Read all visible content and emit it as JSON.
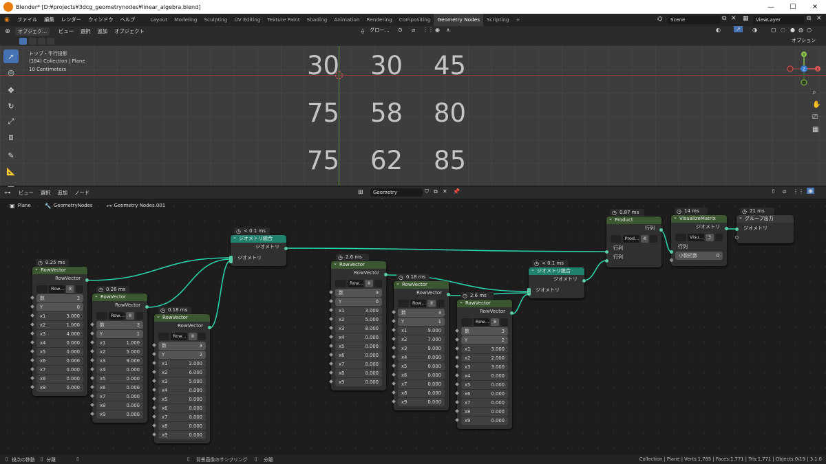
{
  "window": {
    "title": "Blender* [D:¥projects¥3dcg_geometrynodes¥linear_algebra.blend]",
    "min": "—",
    "max": "☐",
    "close": "✕"
  },
  "menu": {
    "items": [
      "ファイル",
      "編集",
      "レンダー",
      "ウィンドウ",
      "ヘルプ"
    ],
    "workspaces": [
      "Layout",
      "Modeling",
      "Sculpting",
      "UV Editing",
      "Texture Paint",
      "Shading",
      "Animation",
      "Rendering",
      "Compositing",
      "Geometry Nodes",
      "Scripting"
    ],
    "add_ws": "+",
    "scene": "Scene",
    "viewlayer": "ViewLayer"
  },
  "viewport_header": {
    "mode": "オブジェク…",
    "items": [
      "ビュー",
      "選択",
      "追加",
      "オブジェクト"
    ],
    "transform": "グロー…",
    "options": "オプション"
  },
  "viewport": {
    "view_name": "トップ・平行投影",
    "collection": "(184) Collection | Plane",
    "scale": "10 Centimeters",
    "matrix": [
      [
        "30",
        "30",
        "45"
      ],
      [
        "75",
        "58",
        "80"
      ],
      [
        "75",
        "62",
        "85"
      ]
    ],
    "gizmo": {
      "y": "Y",
      "x": "X",
      "z": "Z"
    }
  },
  "node_header": {
    "items": [
      "ビュー",
      "選択",
      "追加",
      "ノード"
    ],
    "tree": "Geometry Nodes.001"
  },
  "breadcrumb": {
    "object": "Plane",
    "modifier": "GeometryNodes",
    "tree": "Geometry Nodes.001"
  },
  "nodes": {
    "rv1": {
      "time": "0.25 ms",
      "title": "RowVector",
      "out": "RowVector",
      "sel": "Row…",
      "count": "8",
      "rows": [
        [
          "数",
          "3"
        ],
        [
          "Y",
          "0"
        ],
        [
          "x1",
          "3.000"
        ],
        [
          "x2",
          "1.000"
        ],
        [
          "x3",
          "4.000"
        ],
        [
          "x4",
          "0.000"
        ],
        [
          "x5",
          "0.000"
        ],
        [
          "x6",
          "0.000"
        ],
        [
          "x7",
          "0.000"
        ],
        [
          "x8",
          "0.000"
        ],
        [
          "x9",
          "0.000"
        ]
      ]
    },
    "rv2": {
      "time": "0.26 ms",
      "title": "RowVector",
      "out": "RowVector",
      "sel": "Row…",
      "count": "8",
      "rows": [
        [
          "数",
          "3"
        ],
        [
          "Y",
          "1"
        ],
        [
          "x1",
          "1.000"
        ],
        [
          "x2",
          "5.000"
        ],
        [
          "x3",
          "9.000"
        ],
        [
          "x4",
          "0.000"
        ],
        [
          "x5",
          "0.000"
        ],
        [
          "x6",
          "0.000"
        ],
        [
          "x7",
          "0.000"
        ],
        [
          "x8",
          "0.000"
        ],
        [
          "x9",
          "0.000"
        ]
      ]
    },
    "rv3": {
      "time": "0.18 ms",
      "title": "RowVector",
      "out": "RowVector",
      "sel": "Row…",
      "count": "8",
      "rows": [
        [
          "数",
          "3"
        ],
        [
          "Y",
          "2"
        ],
        [
          "x1",
          "2.000"
        ],
        [
          "x2",
          "6.000"
        ],
        [
          "x3",
          "5.000"
        ],
        [
          "x4",
          "0.000"
        ],
        [
          "x5",
          "0.000"
        ],
        [
          "x6",
          "0.000"
        ],
        [
          "x7",
          "0.000"
        ],
        [
          "x8",
          "0.000"
        ],
        [
          "x9",
          "0.000"
        ]
      ]
    },
    "j1": {
      "time": "< 0.1 ms",
      "title": "ジオメトリ統合",
      "out": "ジオメトリ",
      "in": "ジオメトリ"
    },
    "rv4": {
      "time": "2.6 ms",
      "title": "RowVector",
      "out": "RowVector",
      "sel": "Row…",
      "count": "8",
      "rows": [
        [
          "数",
          "3"
        ],
        [
          "Y",
          "0"
        ],
        [
          "x1",
          "3.000"
        ],
        [
          "x2",
          "5.000"
        ],
        [
          "x3",
          "8.000"
        ],
        [
          "x4",
          "0.000"
        ],
        [
          "x5",
          "0.000"
        ],
        [
          "x6",
          "0.000"
        ],
        [
          "x7",
          "0.000"
        ],
        [
          "x8",
          "0.000"
        ],
        [
          "x9",
          "0.000"
        ]
      ]
    },
    "rv5": {
      "time": "0.18 ms",
      "title": "RowVector",
      "out": "RowVector",
      "sel": "Row…",
      "count": "8",
      "rows": [
        [
          "数",
          "3"
        ],
        [
          "Y",
          "1"
        ],
        [
          "x1",
          "9.000"
        ],
        [
          "x2",
          "7.000"
        ],
        [
          "x3",
          "9.000"
        ],
        [
          "x4",
          "0.000"
        ],
        [
          "x5",
          "0.000"
        ],
        [
          "x6",
          "0.000"
        ],
        [
          "x7",
          "0.000"
        ],
        [
          "x8",
          "0.000"
        ],
        [
          "x9",
          "0.000"
        ]
      ]
    },
    "rv6": {
      "time": "2.6 ms",
      "title": "RowVector",
      "out": "RowVector",
      "sel": "Row…",
      "count": "8",
      "rows": [
        [
          "数",
          "3"
        ],
        [
          "Y",
          "2"
        ],
        [
          "x1",
          "3.000"
        ],
        [
          "x2",
          "2.000"
        ],
        [
          "x3",
          "3.000"
        ],
        [
          "x4",
          "0.000"
        ],
        [
          "x5",
          "0.000"
        ],
        [
          "x6",
          "0.000"
        ],
        [
          "x7",
          "0.000"
        ],
        [
          "x8",
          "0.000"
        ],
        [
          "x9",
          "0.000"
        ]
      ]
    },
    "j2": {
      "time": "< 0.1 ms",
      "title": "ジオメトリ統合",
      "out": "ジオメトリ",
      "in": "ジオメトリ"
    },
    "prod": {
      "time": "0.87 ms",
      "title": "Product",
      "out": "行列",
      "sel": "Prod…",
      "count": "4",
      "in1": "行列",
      "in2": "行列"
    },
    "viz": {
      "time": "14 ms",
      "title": "VisualizeMatrix",
      "out": "ジオメトリ",
      "sel": "Visu…",
      "count": "3",
      "in1": "行列",
      "dec_label": "小数桁数",
      "dec_val": "0"
    },
    "gout": {
      "time": "21 ms",
      "title": "グループ出力",
      "in": "ジオメトリ"
    }
  },
  "status": {
    "left1": "視点の移動",
    "left2": "分離",
    "mid1": "背景画像のサンプリング",
    "mid2": "分離",
    "right": "Collection | Plane | Verts:1,785 | Faces:1,771 | Tris:1,771 | Objects:0/19 | 3.1.0"
  }
}
